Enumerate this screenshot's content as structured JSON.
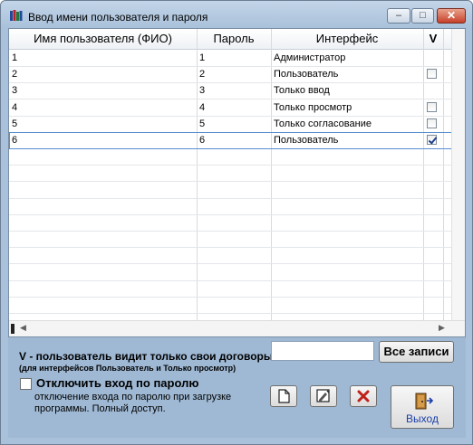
{
  "window": {
    "title": "Ввод имени пользователя и пароля",
    "controls": {
      "minimize": "–",
      "maximize": "□",
      "close": "✕"
    }
  },
  "grid": {
    "columns": [
      "Имя пользователя (ФИО)",
      "Пароль",
      "Интерфейс",
      "V"
    ],
    "rows": [
      {
        "name": "1",
        "password": "1",
        "interface": "Администратор",
        "checkbox": "none"
      },
      {
        "name": "2",
        "password": "2",
        "interface": "Пользователь",
        "checkbox": "unchecked"
      },
      {
        "name": "3",
        "password": "3",
        "interface": "Только ввод",
        "checkbox": "none"
      },
      {
        "name": "4",
        "password": "4",
        "interface": "Только просмотр",
        "checkbox": "unchecked"
      },
      {
        "name": "5",
        "password": "5",
        "interface": "Только согласование",
        "checkbox": "unchecked"
      },
      {
        "name": "6",
        "password": "6",
        "interface": "Пользователь",
        "checkbox": "checked"
      }
    ],
    "scroll_left": "◀",
    "scroll_right": "▶"
  },
  "legend": {
    "line1": "V - пользователь видит только свои договоры",
    "line2": "(для интерфейсов Пользователь и Только просмотр)"
  },
  "search": {
    "value": ""
  },
  "all_records_label": "Все записи",
  "disable_login": {
    "label": "Отключить вход по паролю",
    "description": "отключение входа по паролю при загрузке программы. Полный доступ.",
    "checked": false
  },
  "exit_label": "Выход",
  "icons": {
    "new": "new-document-icon",
    "edit": "edit-icon",
    "delete": "delete-icon",
    "exit": "exit-door-icon"
  },
  "colors": {
    "delete_red": "#c0201a",
    "exit_text": "#1a3fa8",
    "checkmark": "#1d3f8a"
  }
}
